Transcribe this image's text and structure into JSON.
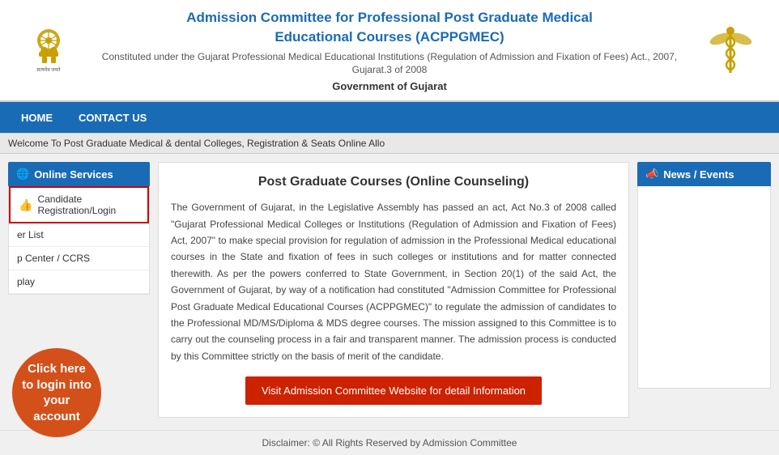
{
  "header": {
    "title_line1": "Admission Committee for Professional Post Graduate Medical",
    "title_line2": "Educational Courses (ACPPGMEC)",
    "subtitle": "Constituted under the Gujarat Professional Medical Educational Institutions (Regulation of Admission and Fixation of Fees) Act., 2007, Gujarat.3 of 2008",
    "gov": "Government of Gujarat"
  },
  "nav": {
    "items": [
      {
        "label": "HOME",
        "id": "home"
      },
      {
        "label": "CONTACT US",
        "id": "contact-us"
      }
    ]
  },
  "ticker": {
    "text": "Welcome To Post Graduate Medical & dental Colleges, Registration & Seats Online Allo"
  },
  "sidebar": {
    "header": "Online Services",
    "globe_icon": "🌐",
    "items": [
      {
        "label": "Candidate Registration/Login",
        "icon": "👍",
        "highlighted": true
      },
      {
        "label": "er List",
        "icon": "",
        "highlighted": false
      },
      {
        "label": "p Center / CCRS",
        "icon": "",
        "highlighted": false
      },
      {
        "label": "play",
        "icon": "",
        "highlighted": false
      }
    ]
  },
  "tooltip": {
    "text": "Click here to login into your account"
  },
  "main": {
    "title": "Post Graduate Courses (Online Counseling)",
    "body": "The Government of Gujarat, in the Legislative Assembly has passed an act, Act No.3 of 2008 called \"Gujarat Professional Medical Colleges or Institutions (Regulation of Admission and Fixation of Fees) Act, 2007\" to make special provision for regulation of admission in the Professional Medical educational courses in the State and fixation of fees in such colleges or institutions and for matter connected therewith. As per the powers conferred to State Government, in Section 20(1) of the said Act, the Government of Gujarat, by way of a notification had constituted \"Admission Committee for Professional Post Graduate Medical Educational Courses (ACPPGMEC)\" to regulate the admission of candidates to the Professional MD/MS/Diploma & MDS degree courses. The mission assigned to this Committee is to carry out the counseling process in a fair and transparent manner. The admission process is conducted by this Committee strictly on the basis of merit of the candidate.",
    "visit_button": "Visit Admission Committee Website for detail Information"
  },
  "news": {
    "header": "News / Events",
    "megaphone_icon": "📣"
  },
  "footer": {
    "text": "Disclaimer: © All Rights Reserved by Admission Committee",
    "link_text": "Admission Committee"
  }
}
